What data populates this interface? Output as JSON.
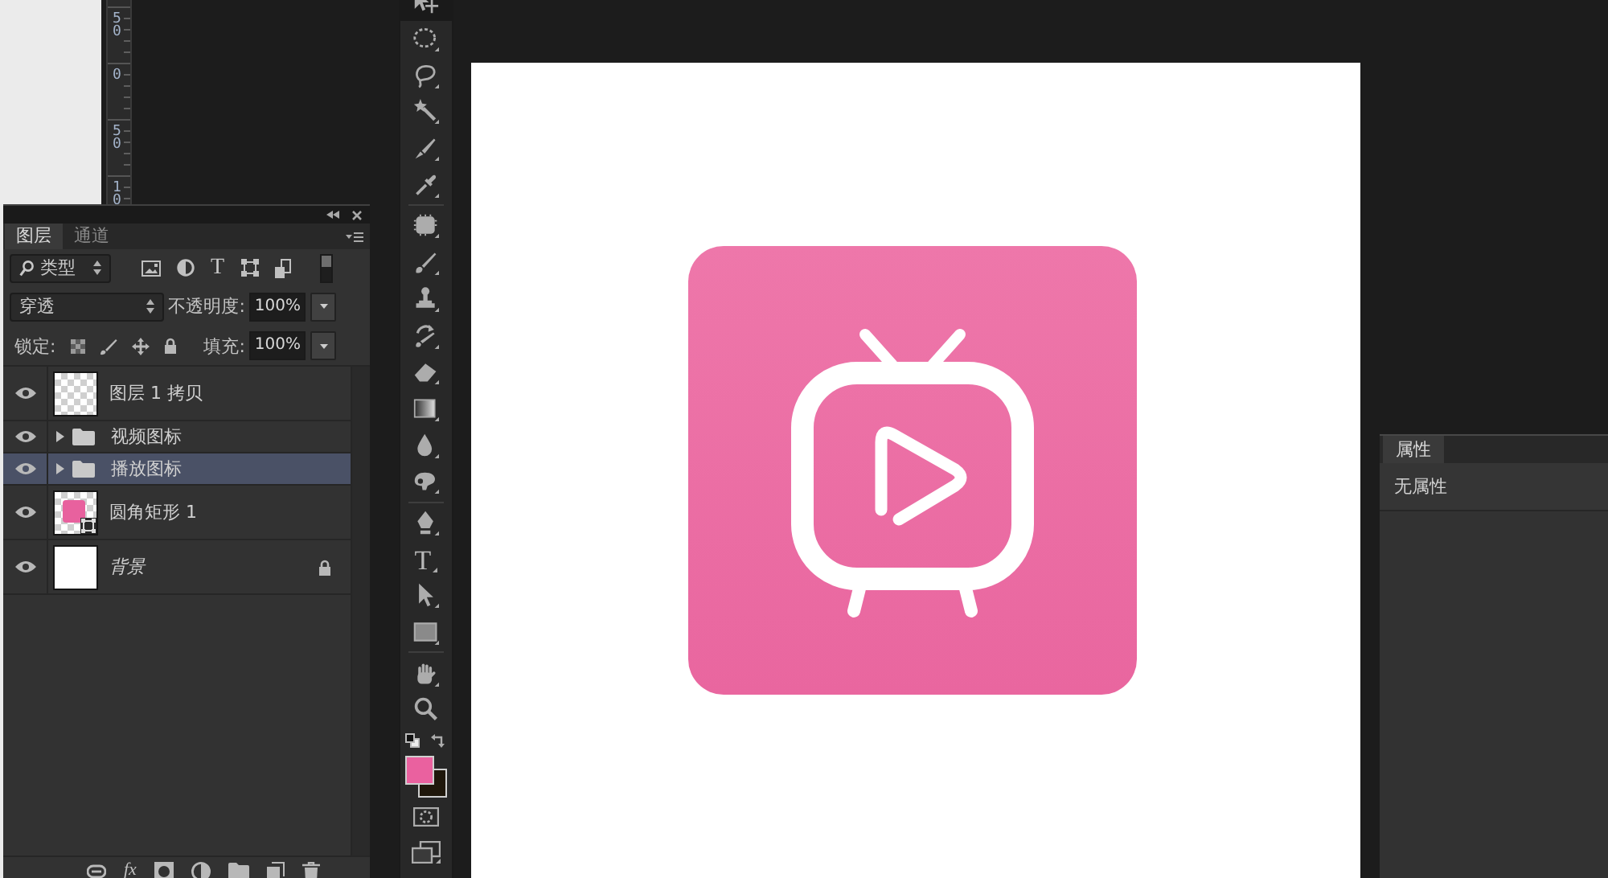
{
  "ruler": {
    "labels": [
      "50",
      "0",
      "50",
      "10"
    ]
  },
  "layers_panel": {
    "tabs": [
      {
        "label": "图层",
        "selected": true
      },
      {
        "label": "通道",
        "selected": false
      }
    ],
    "filter": {
      "value": "类型",
      "type_glyph": "T"
    },
    "blend_mode": {
      "value": "穿透"
    },
    "opacity": {
      "label": "不透明度:",
      "value": "100%"
    },
    "lock": {
      "label": "锁定:"
    },
    "fill": {
      "label": "填充:",
      "value": "100%"
    },
    "layers": [
      {
        "kind": "layer",
        "name": "图层 1 拷贝",
        "visible": true,
        "selected": false,
        "locked": false
      },
      {
        "kind": "group",
        "name": "视频图标",
        "visible": true,
        "selected": false,
        "expanded": false,
        "locked": false
      },
      {
        "kind": "group",
        "name": "播放图标",
        "visible": true,
        "selected": true,
        "expanded": false,
        "locked": false
      },
      {
        "kind": "shape",
        "name": "圆角矩形 1",
        "visible": true,
        "selected": false,
        "locked": false
      },
      {
        "kind": "background",
        "name": "背景",
        "visible": true,
        "selected": false,
        "locked": true
      }
    ],
    "footer": {
      "fx_glyph": "fx"
    }
  },
  "toolbar": {
    "groups": [
      {
        "tools": [
          {
            "kind": "move",
            "selected": true
          },
          {
            "kind": "marquee",
            "selected": false
          },
          {
            "kind": "lasso",
            "selected": false
          },
          {
            "kind": "wand",
            "selected": false
          },
          {
            "kind": "quick",
            "selected": false
          },
          {
            "kind": "eyedropper",
            "selected": false
          }
        ]
      },
      {
        "tools": [
          {
            "kind": "heal",
            "selected": false
          },
          {
            "kind": "brush",
            "selected": false
          },
          {
            "kind": "stamp",
            "selected": false
          },
          {
            "kind": "history",
            "selected": false
          },
          {
            "kind": "eraser",
            "selected": false
          },
          {
            "kind": "gradient",
            "selected": false
          },
          {
            "kind": "blur",
            "selected": false
          },
          {
            "kind": "dodge",
            "selected": false
          }
        ]
      },
      {
        "tools": [
          {
            "kind": "pen",
            "selected": false
          },
          {
            "kind": "type",
            "glyph": "T",
            "selected": false
          },
          {
            "kind": "path",
            "selected": false
          },
          {
            "kind": "rect",
            "selected": false
          }
        ]
      },
      {
        "tools": [
          {
            "kind": "hand",
            "selected": false
          },
          {
            "kind": "zoom",
            "selected": false
          }
        ]
      }
    ]
  },
  "properties_panel": {
    "tabs": [
      {
        "label": "属性",
        "selected": true
      }
    ],
    "message": "无属性"
  }
}
